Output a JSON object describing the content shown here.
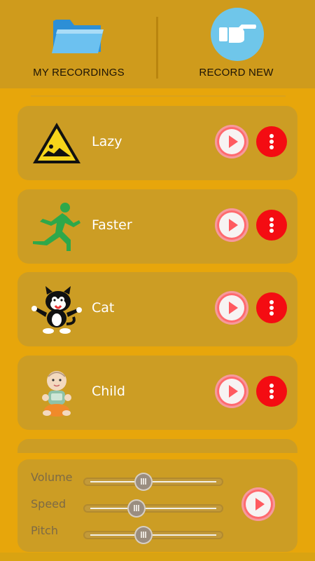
{
  "header": {
    "my_recordings_label": "MY RECORDINGS",
    "record_new_label": "RECORD NEW"
  },
  "recordings": [
    {
      "name": "Lazy",
      "icon": "lazy-sign-icon"
    },
    {
      "name": "Faster",
      "icon": "running-man-icon"
    },
    {
      "name": "Cat",
      "icon": "cartoon-cat-icon"
    },
    {
      "name": "Child",
      "icon": "baby-icon"
    }
  ],
  "controls": {
    "volume_label": "Volume",
    "speed_label": "Speed",
    "pitch_label": "Pitch",
    "volume_level": 0.42,
    "speed_level": 0.36,
    "pitch_level": 0.42
  },
  "colors": {
    "background": "#e7a60b",
    "card": "#cc9d24",
    "play": "#ff6a6f",
    "more": "#f40c12",
    "record_circle": "#6fc6ea"
  }
}
